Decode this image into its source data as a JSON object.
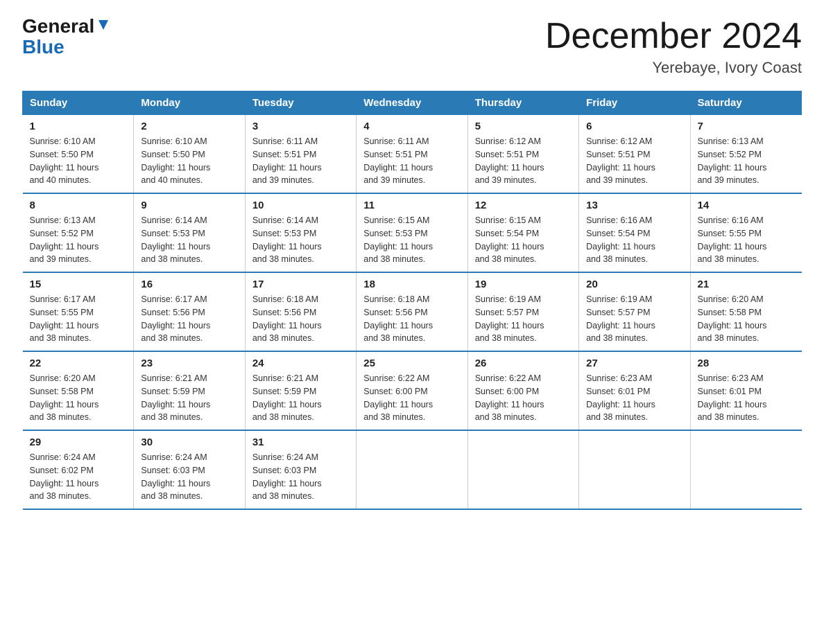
{
  "logo": {
    "part1": "General",
    "part2": "Blue"
  },
  "title": "December 2024",
  "subtitle": "Yerebaye, Ivory Coast",
  "days_of_week": [
    "Sunday",
    "Monday",
    "Tuesday",
    "Wednesday",
    "Thursday",
    "Friday",
    "Saturday"
  ],
  "weeks": [
    [
      {
        "day": "1",
        "sunrise": "6:10 AM",
        "sunset": "5:50 PM",
        "daylight": "11 hours and 40 minutes."
      },
      {
        "day": "2",
        "sunrise": "6:10 AM",
        "sunset": "5:50 PM",
        "daylight": "11 hours and 40 minutes."
      },
      {
        "day": "3",
        "sunrise": "6:11 AM",
        "sunset": "5:51 PM",
        "daylight": "11 hours and 39 minutes."
      },
      {
        "day": "4",
        "sunrise": "6:11 AM",
        "sunset": "5:51 PM",
        "daylight": "11 hours and 39 minutes."
      },
      {
        "day": "5",
        "sunrise": "6:12 AM",
        "sunset": "5:51 PM",
        "daylight": "11 hours and 39 minutes."
      },
      {
        "day": "6",
        "sunrise": "6:12 AM",
        "sunset": "5:51 PM",
        "daylight": "11 hours and 39 minutes."
      },
      {
        "day": "7",
        "sunrise": "6:13 AM",
        "sunset": "5:52 PM",
        "daylight": "11 hours and 39 minutes."
      }
    ],
    [
      {
        "day": "8",
        "sunrise": "6:13 AM",
        "sunset": "5:52 PM",
        "daylight": "11 hours and 39 minutes."
      },
      {
        "day": "9",
        "sunrise": "6:14 AM",
        "sunset": "5:53 PM",
        "daylight": "11 hours and 38 minutes."
      },
      {
        "day": "10",
        "sunrise": "6:14 AM",
        "sunset": "5:53 PM",
        "daylight": "11 hours and 38 minutes."
      },
      {
        "day": "11",
        "sunrise": "6:15 AM",
        "sunset": "5:53 PM",
        "daylight": "11 hours and 38 minutes."
      },
      {
        "day": "12",
        "sunrise": "6:15 AM",
        "sunset": "5:54 PM",
        "daylight": "11 hours and 38 minutes."
      },
      {
        "day": "13",
        "sunrise": "6:16 AM",
        "sunset": "5:54 PM",
        "daylight": "11 hours and 38 minutes."
      },
      {
        "day": "14",
        "sunrise": "6:16 AM",
        "sunset": "5:55 PM",
        "daylight": "11 hours and 38 minutes."
      }
    ],
    [
      {
        "day": "15",
        "sunrise": "6:17 AM",
        "sunset": "5:55 PM",
        "daylight": "11 hours and 38 minutes."
      },
      {
        "day": "16",
        "sunrise": "6:17 AM",
        "sunset": "5:56 PM",
        "daylight": "11 hours and 38 minutes."
      },
      {
        "day": "17",
        "sunrise": "6:18 AM",
        "sunset": "5:56 PM",
        "daylight": "11 hours and 38 minutes."
      },
      {
        "day": "18",
        "sunrise": "6:18 AM",
        "sunset": "5:56 PM",
        "daylight": "11 hours and 38 minutes."
      },
      {
        "day": "19",
        "sunrise": "6:19 AM",
        "sunset": "5:57 PM",
        "daylight": "11 hours and 38 minutes."
      },
      {
        "day": "20",
        "sunrise": "6:19 AM",
        "sunset": "5:57 PM",
        "daylight": "11 hours and 38 minutes."
      },
      {
        "day": "21",
        "sunrise": "6:20 AM",
        "sunset": "5:58 PM",
        "daylight": "11 hours and 38 minutes."
      }
    ],
    [
      {
        "day": "22",
        "sunrise": "6:20 AM",
        "sunset": "5:58 PM",
        "daylight": "11 hours and 38 minutes."
      },
      {
        "day": "23",
        "sunrise": "6:21 AM",
        "sunset": "5:59 PM",
        "daylight": "11 hours and 38 minutes."
      },
      {
        "day": "24",
        "sunrise": "6:21 AM",
        "sunset": "5:59 PM",
        "daylight": "11 hours and 38 minutes."
      },
      {
        "day": "25",
        "sunrise": "6:22 AM",
        "sunset": "6:00 PM",
        "daylight": "11 hours and 38 minutes."
      },
      {
        "day": "26",
        "sunrise": "6:22 AM",
        "sunset": "6:00 PM",
        "daylight": "11 hours and 38 minutes."
      },
      {
        "day": "27",
        "sunrise": "6:23 AM",
        "sunset": "6:01 PM",
        "daylight": "11 hours and 38 minutes."
      },
      {
        "day": "28",
        "sunrise": "6:23 AM",
        "sunset": "6:01 PM",
        "daylight": "11 hours and 38 minutes."
      }
    ],
    [
      {
        "day": "29",
        "sunrise": "6:24 AM",
        "sunset": "6:02 PM",
        "daylight": "11 hours and 38 minutes."
      },
      {
        "day": "30",
        "sunrise": "6:24 AM",
        "sunset": "6:03 PM",
        "daylight": "11 hours and 38 minutes."
      },
      {
        "day": "31",
        "sunrise": "6:24 AM",
        "sunset": "6:03 PM",
        "daylight": "11 hours and 38 minutes."
      },
      null,
      null,
      null,
      null
    ]
  ],
  "labels": {
    "sunrise": "Sunrise:",
    "sunset": "Sunset:",
    "daylight": "Daylight:"
  }
}
